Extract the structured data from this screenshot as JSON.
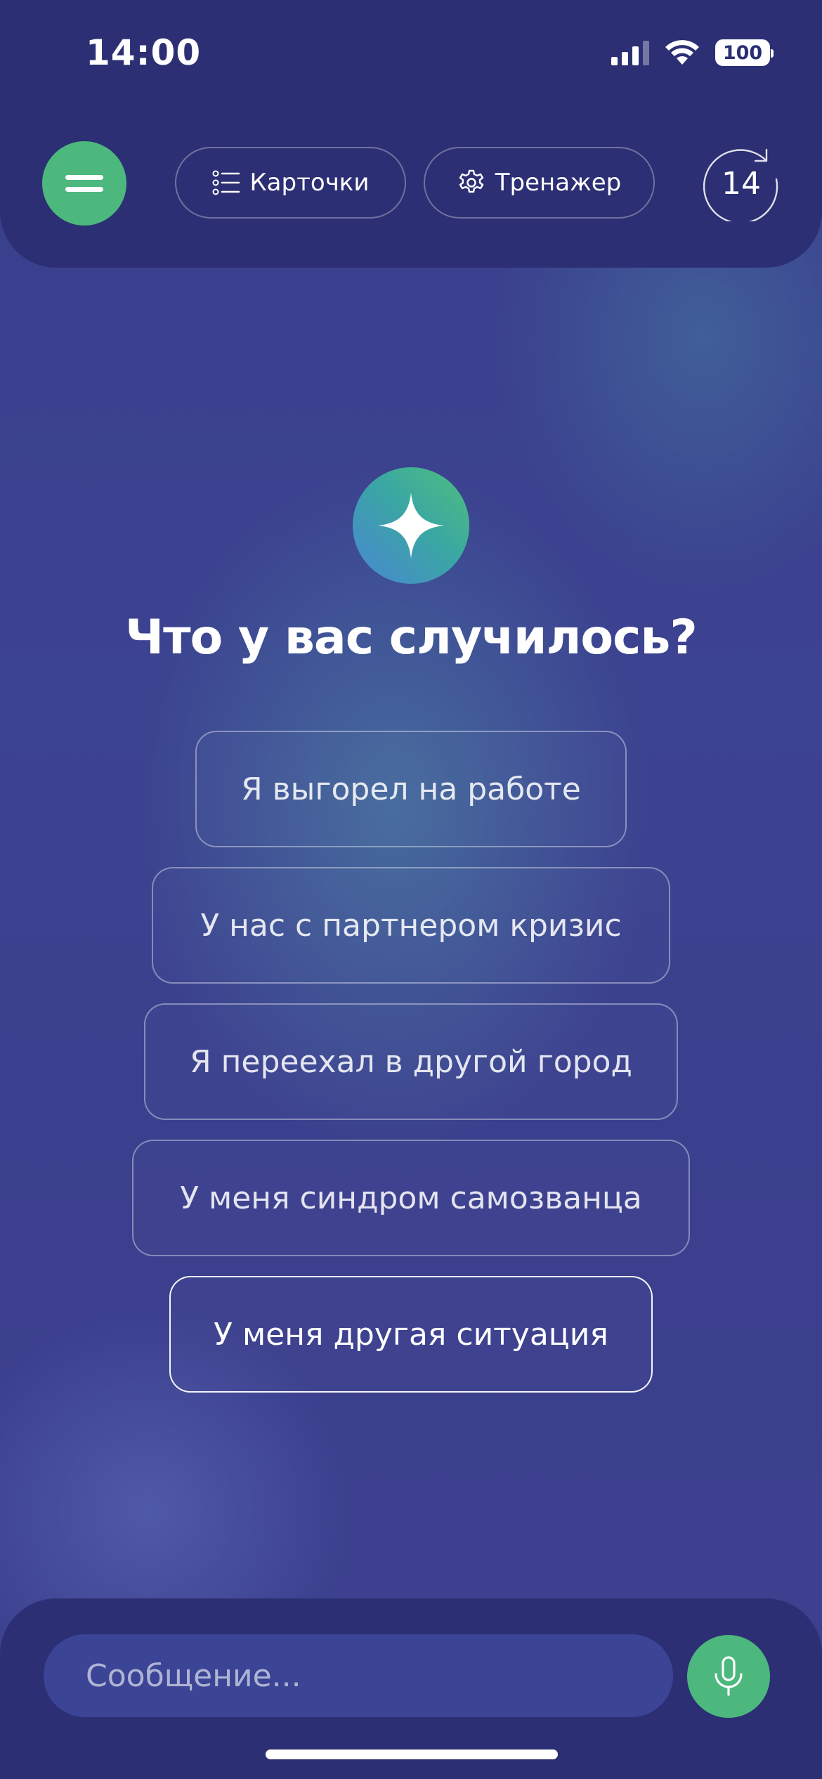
{
  "status_bar": {
    "time": "14:00",
    "battery": "100",
    "icons": [
      "signal-icon",
      "wifi-icon",
      "battery-icon"
    ]
  },
  "header": {
    "menu_icon": "menu-icon",
    "cards_label": "Карточки",
    "cards_icon": "list-icon",
    "trainer_label": "Тренажер",
    "trainer_icon": "gear-icon",
    "counter_value": "14",
    "counter_icon": "refresh-counter-icon"
  },
  "main": {
    "badge_icon": "sparkle-icon",
    "title": "Что у вас случилось?",
    "options": [
      {
        "label": "Я выгорел на работе"
      },
      {
        "label": "У нас с партнером кризис"
      },
      {
        "label": "Я переехал в другой город"
      },
      {
        "label": "У меня синдром самозванца"
      },
      {
        "label": "У меня другая ситуация",
        "highlighted": true
      }
    ]
  },
  "composer": {
    "placeholder": "Сообщение...",
    "mic_icon": "microphone-icon"
  },
  "colors": {
    "accent_green": "#4cb87d",
    "panel_navy": "#2c2f73",
    "background": "#3c4390",
    "input_bg": "#3b4495"
  }
}
